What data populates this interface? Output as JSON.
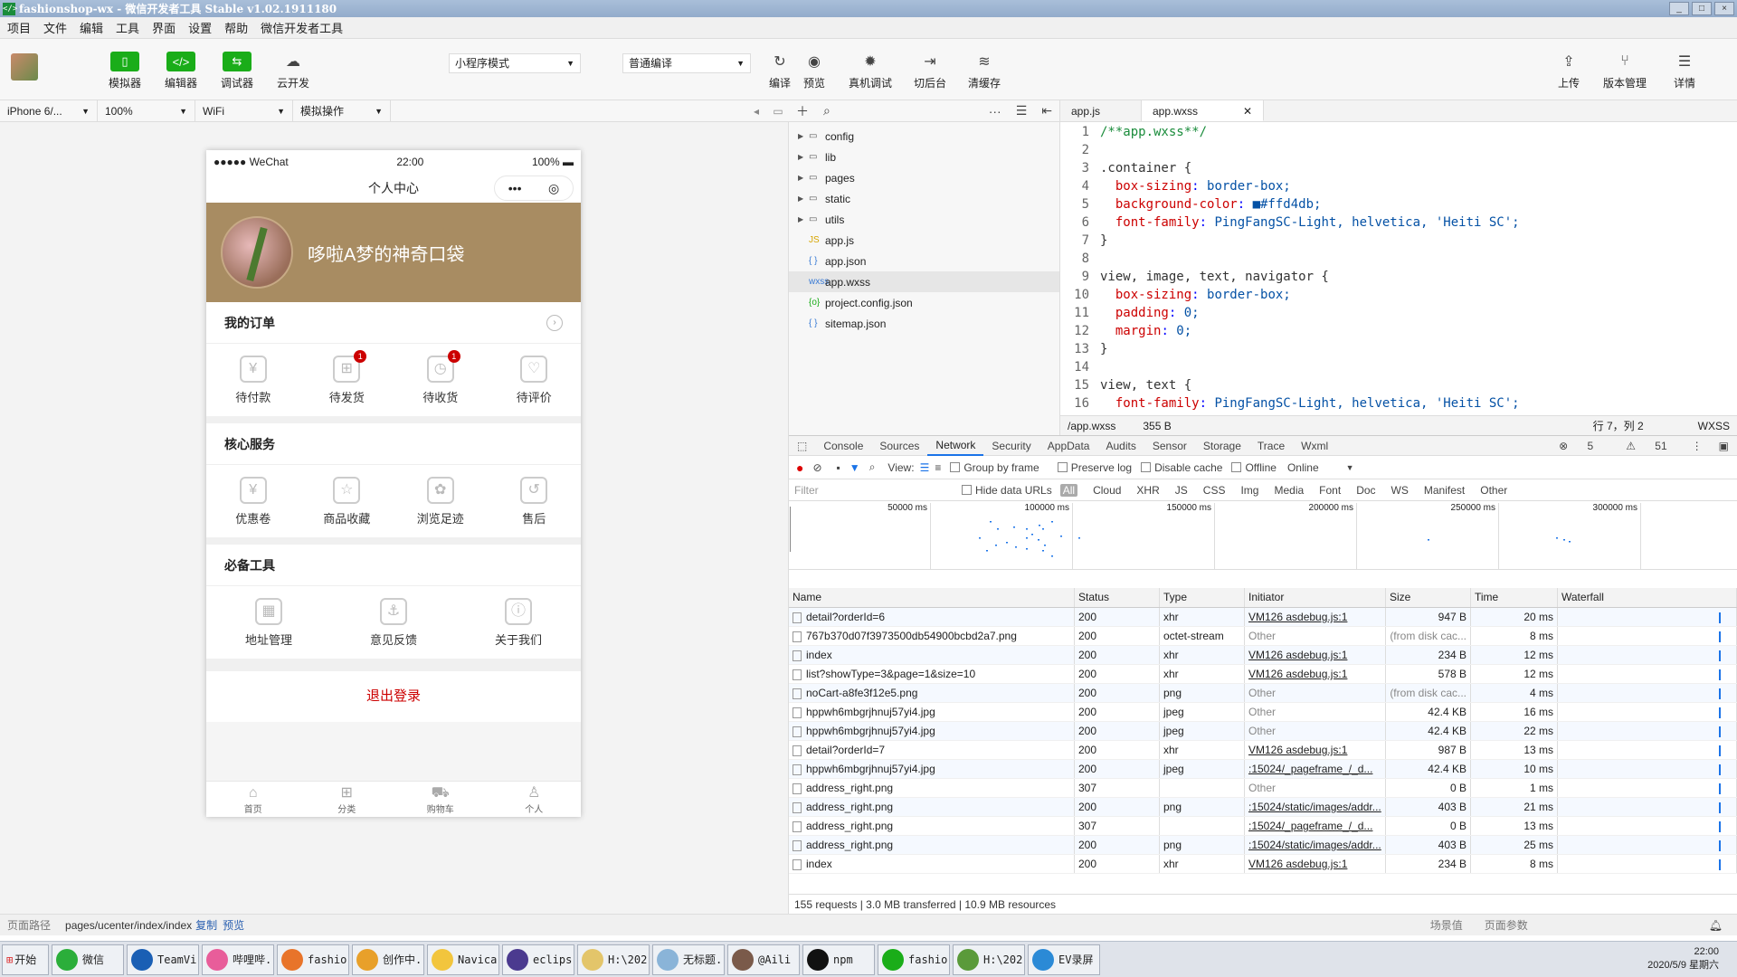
{
  "window": {
    "title": "fashionshop-wx - 微信开发者工具 Stable v1.02.1911180",
    "icon": "</>"
  },
  "menu": [
    "项目",
    "文件",
    "编辑",
    "工具",
    "界面",
    "设置",
    "帮助",
    "微信开发者工具"
  ],
  "toolbar": {
    "simulator": "模拟器",
    "editor": "编辑器",
    "debugger": "调试器",
    "cloud": "云开发",
    "mode": "小程序模式",
    "compile_mode": "普通编译",
    "compile": "编译",
    "preview": "预览",
    "remote_debug": "真机调试",
    "background": "切后台",
    "clear_cache": "清缓存",
    "upload": "上传",
    "version": "版本管理",
    "details": "详情"
  },
  "simbar": {
    "device": "iPhone 6/...",
    "zoom": "100%",
    "network": "WiFi",
    "ops": "模拟操作"
  },
  "phone": {
    "carrier": "●●●●● WeChat",
    "time": "22:00",
    "battery": "100%",
    "nav_title": "个人中心",
    "capsule_more": "•••",
    "capsule_close": "◎",
    "username": "哆啦A梦的神奇口袋",
    "orders": {
      "title": "我的订单",
      "items": [
        {
          "label": "待付款",
          "icon": "¥",
          "badge": ""
        },
        {
          "label": "待发货",
          "icon": "⊞",
          "badge": "1"
        },
        {
          "label": "待收货",
          "icon": "◷",
          "badge": "1"
        },
        {
          "label": "待评价",
          "icon": "♡",
          "badge": ""
        }
      ]
    },
    "services": {
      "title": "核心服务",
      "items": [
        {
          "label": "优惠卷",
          "icon": "¥"
        },
        {
          "label": "商品收藏",
          "icon": "☆"
        },
        {
          "label": "浏览足迹",
          "icon": "✿"
        },
        {
          "label": "售后",
          "icon": "↺"
        }
      ]
    },
    "tools": {
      "title": "必备工具",
      "items": [
        {
          "label": "地址管理",
          "icon": "▦"
        },
        {
          "label": "意见反馈",
          "icon": "⚓"
        },
        {
          "label": "关于我们",
          "icon": "ⓘ"
        }
      ]
    },
    "logout": "退出登录",
    "tabs": [
      {
        "label": "首页",
        "icon": "⌂"
      },
      {
        "label": "分类",
        "icon": "⊞"
      },
      {
        "label": "购物车",
        "icon": "⛟"
      },
      {
        "label": "个人",
        "icon": "♙"
      }
    ]
  },
  "filetree": [
    {
      "name": "config",
      "type": "folder"
    },
    {
      "name": "lib",
      "type": "folder"
    },
    {
      "name": "pages",
      "type": "folder"
    },
    {
      "name": "static",
      "type": "folder"
    },
    {
      "name": "utils",
      "type": "folder"
    },
    {
      "name": "app.js",
      "type": "js"
    },
    {
      "name": "app.json",
      "type": "json"
    },
    {
      "name": "app.wxss",
      "type": "wxss"
    },
    {
      "name": "project.config.json",
      "type": "cfg"
    },
    {
      "name": "sitemap.json",
      "type": "json"
    }
  ],
  "editor": {
    "tabs": [
      "app.js",
      "app.wxss"
    ],
    "lines": [
      "/**app.wxss**/",
      "",
      ".container {",
      "  box-sizing: border-box;",
      "  background-color: ■#ffd4db;",
      "  font-family: PingFangSC-Light, helvetica, 'Heiti SC';",
      "}",
      "",
      "view, image, text, navigator {",
      "  box-sizing: border-box;",
      "  padding: 0;",
      "  margin: 0;",
      "}",
      "",
      "view, text {",
      "  font-family: PingFangSC-Light, helvetica, 'Heiti SC';"
    ],
    "status": {
      "path": "/app.wxss",
      "size": "355 B",
      "pos": "行 7，列 2",
      "lang": "WXSS"
    }
  },
  "devtools": {
    "tabs": [
      "Console",
      "Sources",
      "Network",
      "Security",
      "AppData",
      "Audits",
      "Sensor",
      "Storage",
      "Trace",
      "Wxml"
    ],
    "errors": "5",
    "warnings": "51",
    "net_tool": {
      "view": "View:",
      "group": "Group by frame",
      "preserve": "Preserve log",
      "cache": "Disable cache",
      "offline": "Offline",
      "online": "Online"
    },
    "filter": {
      "placeholder": "Filter",
      "hide": "Hide data URLs",
      "types": [
        "Cloud",
        "XHR",
        "JS",
        "CSS",
        "Img",
        "Media",
        "Font",
        "Doc",
        "WS",
        "Manifest",
        "Other"
      ],
      "all": "All"
    },
    "ticks": [
      "50000 ms",
      "100000 ms",
      "150000 ms",
      "200000 ms",
      "250000 ms",
      "300000 ms"
    ],
    "columns": [
      "Name",
      "Status",
      "Type",
      "Initiator",
      "Size",
      "Time",
      "Waterfall"
    ],
    "rows": [
      {
        "name": "detail?orderId=6",
        "status": "200",
        "type": "xhr",
        "init": "VM126 asdebug.js:1",
        "size": "947 B",
        "time": "20 ms",
        "link": true
      },
      {
        "name": "767b370d07f3973500db54900bcbd2a7.png",
        "status": "200",
        "type": "octet-stream",
        "init": "Other",
        "size": "(from disk cac...",
        "time": "8 ms",
        "link": false
      },
      {
        "name": "index",
        "status": "200",
        "type": "xhr",
        "init": "VM126 asdebug.js:1",
        "size": "234 B",
        "time": "12 ms",
        "link": true
      },
      {
        "name": "list?showType=3&page=1&size=10",
        "status": "200",
        "type": "xhr",
        "init": "VM126 asdebug.js:1",
        "size": "578 B",
        "time": "12 ms",
        "link": true
      },
      {
        "name": "noCart-a8fe3f12e5.png",
        "status": "200",
        "type": "png",
        "init": "Other",
        "size": "(from disk cac...",
        "time": "4 ms",
        "link": false
      },
      {
        "name": "hppwh6mbgrjhnuj57yi4.jpg",
        "status": "200",
        "type": "jpeg",
        "init": "Other",
        "size": "42.4 KB",
        "time": "16 ms",
        "link": false
      },
      {
        "name": "hppwh6mbgrjhnuj57yi4.jpg",
        "status": "200",
        "type": "jpeg",
        "init": "Other",
        "size": "42.4 KB",
        "time": "22 ms",
        "link": false
      },
      {
        "name": "detail?orderId=7",
        "status": "200",
        "type": "xhr",
        "init": "VM126 asdebug.js:1",
        "size": "987 B",
        "time": "13 ms",
        "link": true
      },
      {
        "name": "hppwh6mbgrjhnuj57yi4.jpg",
        "status": "200",
        "type": "jpeg",
        "init": ":15024/_pageframe_/_d...",
        "size": "42.4 KB",
        "time": "10 ms",
        "link": true
      },
      {
        "name": "address_right.png",
        "status": "307",
        "type": "",
        "init": "Other",
        "size": "0 B",
        "time": "1 ms",
        "link": false
      },
      {
        "name": "address_right.png",
        "status": "200",
        "type": "png",
        "init": ":15024/static/images/addr...",
        "size": "403 B",
        "time": "21 ms",
        "link": true
      },
      {
        "name": "address_right.png",
        "status": "307",
        "type": "",
        "init": ":15024/_pageframe_/_d...",
        "size": "0 B",
        "time": "13 ms",
        "link": true
      },
      {
        "name": "address_right.png",
        "status": "200",
        "type": "png",
        "init": ":15024/static/images/addr...",
        "size": "403 B",
        "time": "25 ms",
        "link": true
      },
      {
        "name": "index",
        "status": "200",
        "type": "xhr",
        "init": "VM126 asdebug.js:1",
        "size": "234 B",
        "time": "8 ms",
        "link": true
      }
    ],
    "summary": "155 requests  |  3.0 MB transferred  |  10.9 MB resources"
  },
  "pathbar": {
    "label": "页面路径",
    "path": "pages/ucenter/index/index",
    "copy": "复制",
    "preview": "预览",
    "scene": "场景值",
    "params": "页面参数"
  },
  "taskbar": {
    "start": "开始",
    "items": [
      {
        "label": "微信",
        "color": "#2bae3a"
      },
      {
        "label": "TeamVi...",
        "color": "#1a5fb4"
      },
      {
        "label": "哔哩哔...",
        "color": "#e85d9a"
      },
      {
        "label": "fashio...",
        "color": "#e8742a"
      },
      {
        "label": "创作中...",
        "color": "#e8a02a"
      },
      {
        "label": "Navica...",
        "color": "#f2c53d"
      },
      {
        "label": "eclips...",
        "color": "#4b3a8f"
      },
      {
        "label": "H:\\202...",
        "color": "#e3c56a"
      },
      {
        "label": "无标题...",
        "color": "#8ab4d8"
      },
      {
        "label": "@Aili",
        "color": "#7a5a4a"
      },
      {
        "label": "npm",
        "color": "#111111"
      },
      {
        "label": "fashio...",
        "color": "#1aad19"
      },
      {
        "label": "H:\\202...",
        "color": "#5a9a3a"
      },
      {
        "label": "EV录屏",
        "color": "#2b8ad6"
      }
    ],
    "time": "22:00",
    "date": "2020/5/9 星期六"
  }
}
